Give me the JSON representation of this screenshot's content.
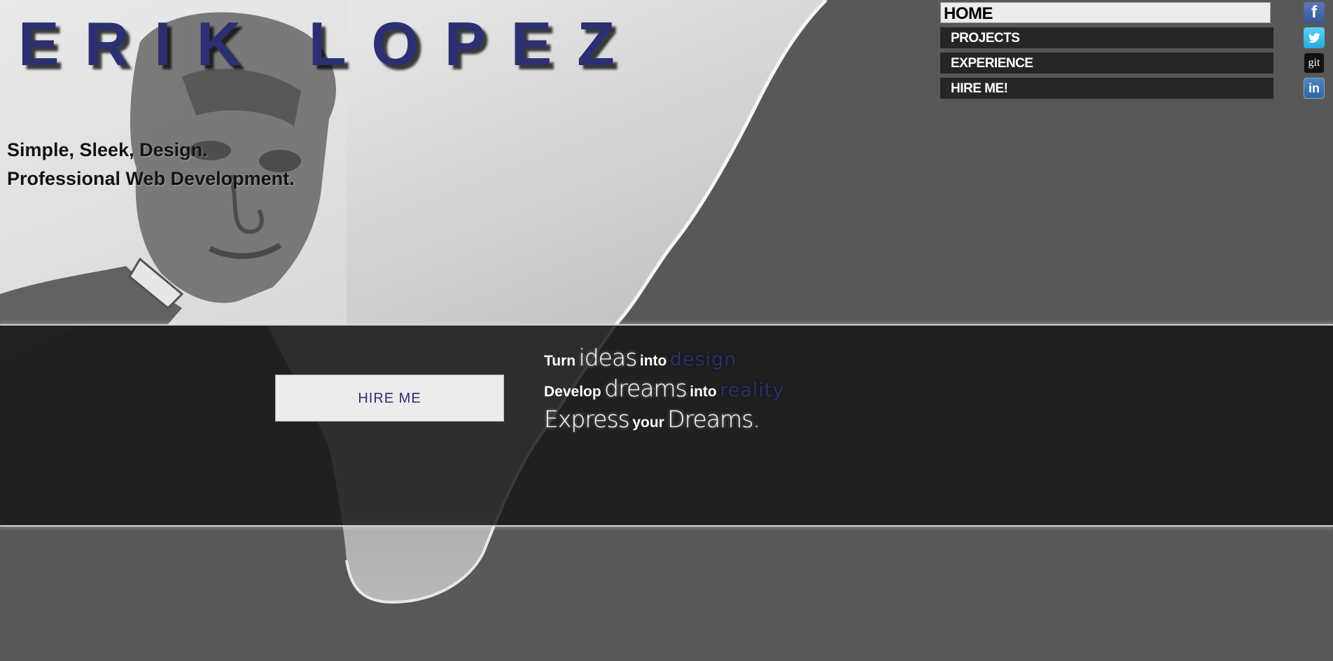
{
  "header": {
    "logo_text": "ERIK LOPEZ",
    "tagline": [
      "Simple, Sleek, Design.",
      "Professional Web Development."
    ]
  },
  "nav": {
    "items": [
      {
        "label": "HOME",
        "active": true
      },
      {
        "label": "PROJECTS",
        "active": false
      },
      {
        "label": "EXPERIENCE",
        "active": false
      },
      {
        "label": "HIRE ME!",
        "active": false
      }
    ]
  },
  "social": [
    {
      "name": "facebook-icon",
      "glyph": "f"
    },
    {
      "name": "twitter-icon",
      "glyph": "🐦"
    },
    {
      "name": "github-icon",
      "glyph": "git"
    },
    {
      "name": "linkedin-icon",
      "glyph": "in"
    }
  ],
  "hero": {
    "hire_button": "HIRE ME",
    "slogans": [
      {
        "w1": "Turn",
        "w2": "ideas",
        "w3": "into",
        "w4": "design"
      },
      {
        "w1": "Develop",
        "w2": "dreams",
        "w3": "into",
        "w4": "reality"
      },
      {
        "w1": "Express",
        "w2": "your",
        "w3": "Dreams."
      }
    ]
  },
  "colors": {
    "accent": "#2a3071",
    "background": "#585858",
    "band": "#222222",
    "nav_item": "#262626",
    "nav_active": "#ececec"
  }
}
